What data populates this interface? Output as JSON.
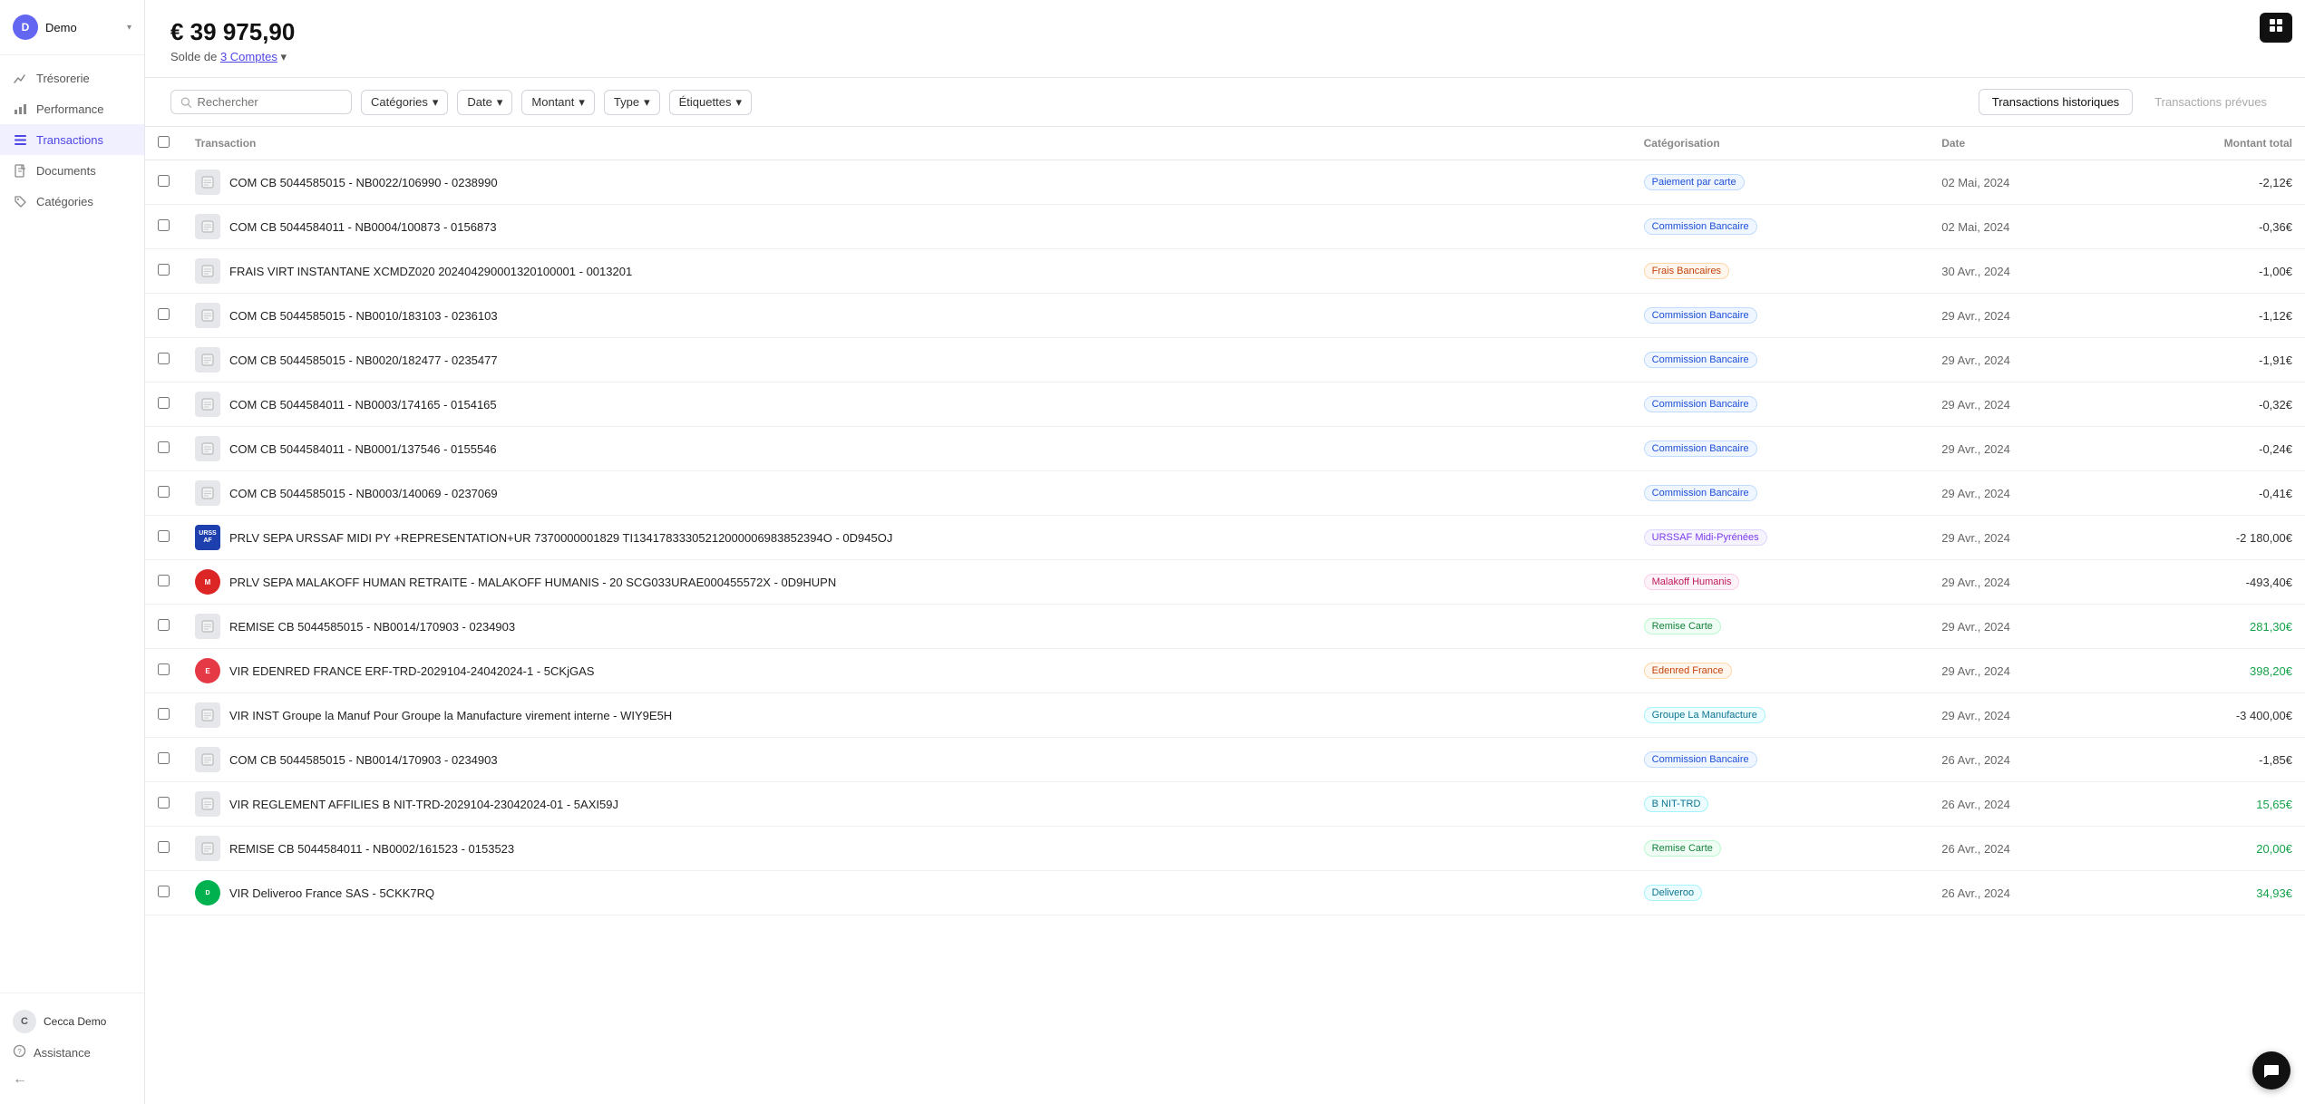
{
  "sidebar": {
    "demo_label": "Demo",
    "demo_avatar": "D",
    "nav_items": [
      {
        "id": "tresorerie",
        "label": "Trésorerie",
        "icon": "chart-icon",
        "active": false
      },
      {
        "id": "performance",
        "label": "Performance",
        "icon": "bar-icon",
        "active": false
      },
      {
        "id": "transactions",
        "label": "Transactions",
        "icon": "list-icon",
        "active": true
      },
      {
        "id": "documents",
        "label": "Documents",
        "icon": "file-icon",
        "active": false
      },
      {
        "id": "categories",
        "label": "Catégories",
        "icon": "tag-icon",
        "active": false
      }
    ],
    "user_name": "Cecca Demo",
    "user_initials": "C",
    "assistance_label": "Assistance",
    "collapse_icon": "←"
  },
  "header": {
    "amount": "€ 39 975,90",
    "subtitle_prefix": "Solde de",
    "subtitle_link": "3 Comptes",
    "subtitle_suffix": ""
  },
  "toolbar": {
    "search_placeholder": "Rechercher",
    "filters": [
      {
        "id": "categories",
        "label": "Catégories",
        "has_chevron": true
      },
      {
        "id": "date",
        "label": "Date",
        "has_chevron": true
      },
      {
        "id": "montant",
        "label": "Montant",
        "has_chevron": true
      },
      {
        "id": "type",
        "label": "Type",
        "has_chevron": true
      },
      {
        "id": "etiquettes",
        "label": "Étiquettes",
        "has_chevron": true
      }
    ],
    "tab_historique": "Transactions historiques",
    "tab_prevues": "Transactions prévues"
  },
  "table": {
    "columns": [
      {
        "id": "checkbox",
        "label": ""
      },
      {
        "id": "transaction",
        "label": "Transaction"
      },
      {
        "id": "categorisation",
        "label": "Catégorisation"
      },
      {
        "id": "date",
        "label": "Date"
      },
      {
        "id": "montant",
        "label": "Montant total",
        "align": "right"
      }
    ],
    "rows": [
      {
        "id": 1,
        "logo_type": "generic",
        "name": "COM CB 5044585015 - NB0022/106990 - 0238990",
        "badge_label": "Paiement par carte",
        "badge_style": "blue",
        "date": "02 Mai, 2024",
        "amount": "-2,12€",
        "amount_type": "neg"
      },
      {
        "id": 2,
        "logo_type": "generic",
        "name": "COM CB 5044584011 - NB0004/100873 - 0156873",
        "badge_label": "Commission Bancaire",
        "badge_style": "blue",
        "date": "02 Mai, 2024",
        "amount": "-0,36€",
        "amount_type": "neg"
      },
      {
        "id": 3,
        "logo_type": "generic",
        "name": "FRAIS VIRT INSTANTANE XCMDZ020 202404290001320100001 - 0013201",
        "badge_label": "Frais Bancaires",
        "badge_style": "orange",
        "date": "30 Avr., 2024",
        "amount": "-1,00€",
        "amount_type": "neg"
      },
      {
        "id": 4,
        "logo_type": "generic",
        "name": "COM CB 5044585015 - NB0010/183103 - 0236103",
        "badge_label": "Commission Bancaire",
        "badge_style": "blue",
        "date": "29 Avr., 2024",
        "amount": "-1,12€",
        "amount_type": "neg"
      },
      {
        "id": 5,
        "logo_type": "generic",
        "name": "COM CB 5044585015 - NB0020/182477 - 0235477",
        "badge_label": "Commission Bancaire",
        "badge_style": "blue",
        "date": "29 Avr., 2024",
        "amount": "-1,91€",
        "amount_type": "neg"
      },
      {
        "id": 6,
        "logo_type": "generic",
        "name": "COM CB 5044584011 - NB0003/174165 - 0154165",
        "badge_label": "Commission Bancaire",
        "badge_style": "blue",
        "date": "29 Avr., 2024",
        "amount": "-0,32€",
        "amount_type": "neg"
      },
      {
        "id": 7,
        "logo_type": "generic",
        "name": "COM CB 5044584011 - NB0001/137546 - 0155546",
        "badge_label": "Commission Bancaire",
        "badge_style": "blue",
        "date": "29 Avr., 2024",
        "amount": "-0,24€",
        "amount_type": "neg"
      },
      {
        "id": 8,
        "logo_type": "generic",
        "name": "COM CB 5044585015 - NB0003/140069 - 0237069",
        "badge_label": "Commission Bancaire",
        "badge_style": "blue",
        "date": "29 Avr., 2024",
        "amount": "-0,41€",
        "amount_type": "neg"
      },
      {
        "id": 9,
        "logo_type": "urssaf",
        "name": "PRLV SEPA URSSAF MIDI PY +REPRESENTATION+UR 7370000001829 TI13417833305212000006983852394O - 0D945OJ",
        "badge_label": "URSSAF Midi-Pyrénées",
        "badge_style": "purple",
        "date": "29 Avr., 2024",
        "amount": "-2 180,00€",
        "amount_type": "neg"
      },
      {
        "id": 10,
        "logo_type": "malakoff",
        "name": "PRLV SEPA MALAKOFF HUMAN RETRAITE - MALAKOFF HUMANIS - 20 SCG033URAE000455572X - 0D9HUPN",
        "badge_label": "Malakoff Humanis",
        "badge_style": "pink",
        "date": "29 Avr., 2024",
        "amount": "-493,40€",
        "amount_type": "neg"
      },
      {
        "id": 11,
        "logo_type": "generic",
        "name": "REMISE CB 5044585015 - NB0014/170903 - 0234903",
        "badge_label": "Remise Carte",
        "badge_style": "green",
        "date": "29 Avr., 2024",
        "amount": "281,30€",
        "amount_type": "pos"
      },
      {
        "id": 12,
        "logo_type": "edenred",
        "name": "VIR EDENRED FRANCE ERF-TRD-2029104-24042024-1 - 5CKjGAS",
        "badge_label": "Edenred France",
        "badge_style": "orange",
        "date": "29 Avr., 2024",
        "amount": "398,20€",
        "amount_type": "pos"
      },
      {
        "id": 13,
        "logo_type": "generic",
        "name": "VIR INST Groupe la Manuf Pour Groupe la Manufacture virement interne - WIY9E5H",
        "badge_label": "Groupe La Manufacture",
        "badge_style": "teal",
        "date": "29 Avr., 2024",
        "amount": "-3 400,00€",
        "amount_type": "neg"
      },
      {
        "id": 14,
        "logo_type": "generic",
        "name": "COM CB 5044585015 - NB0014/170903 - 0234903",
        "badge_label": "Commission Bancaire",
        "badge_style": "blue",
        "date": "26 Avr., 2024",
        "amount": "-1,85€",
        "amount_type": "neg"
      },
      {
        "id": 15,
        "logo_type": "generic",
        "name": "VIR REGLEMENT AFFILIES B NIT-TRD-2029104-23042024-01 - 5AXI59J",
        "badge_label": "B NIT-TRD",
        "badge_style": "teal",
        "date": "26 Avr., 2024",
        "amount": "15,65€",
        "amount_type": "pos"
      },
      {
        "id": 16,
        "logo_type": "generic",
        "name": "REMISE CB 5044584011 - NB0002/161523 - 0153523",
        "badge_label": "Remise Carte",
        "badge_style": "green",
        "date": "26 Avr., 2024",
        "amount": "20,00€",
        "amount_type": "pos"
      },
      {
        "id": 17,
        "logo_type": "delivery",
        "name": "VIR Deliveroo France SAS - 5CKK7RQ",
        "badge_label": "Deliveroo",
        "badge_style": "teal",
        "date": "26 Avr., 2024",
        "amount": "34,93€",
        "amount_type": "pos"
      }
    ]
  },
  "top_right_icon": "⊞",
  "chat_icon": "💬"
}
